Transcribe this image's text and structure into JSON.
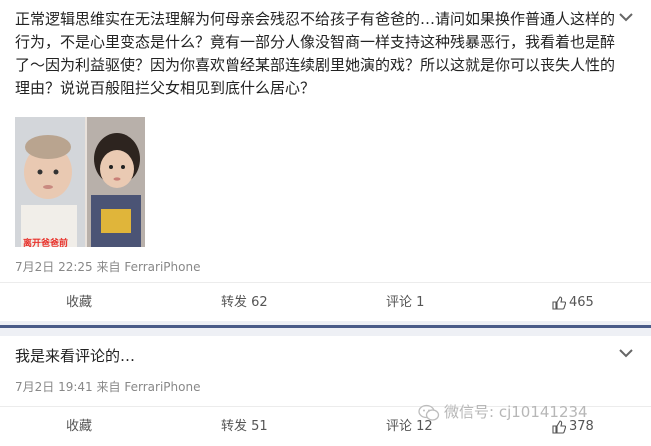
{
  "posts": [
    {
      "text_lines": [
        "正常逻辑思维实在无法理解为何母亲会残忍不给孩子有爸爸的…请问如果换作普通人这样的",
        "行为，不是心里变态是什么？竟有一部分人像没智商一样支持这种残暴恶行，我看着也是醉",
        "了～因为利益驱使？因为你喜欢曾经某部连续剧里她演的戏？所以这就是你可以丧失人性的",
        "理由？说说百般阻拦父女相见到底什么居心？"
      ],
      "image_caption": "离开爸爸前",
      "date": "7月2日",
      "time": "22:25",
      "via": "来自",
      "source": "FerrariPhone",
      "actions": {
        "favorite": "收藏",
        "forward": "转发 62",
        "comment": "评论 1",
        "likes": "465"
      }
    },
    {
      "text_lines": [
        "我是来看评论的…"
      ],
      "date": "7月2日",
      "time": "19:41",
      "via": "来自",
      "source": "FerrariPhone",
      "actions": {
        "favorite": "收藏",
        "forward": "转发 51",
        "comment": "评论 12",
        "likes": "378"
      }
    }
  ],
  "watermark": "微信号: cj10141234",
  "icons": {
    "menu": "chevron-down-icon",
    "like": "thumbs-up-icon",
    "watermark": "wechat-icon"
  },
  "colors": {
    "separator": "#4a5b88",
    "meta_text": "#888888",
    "caption": "#e8322c"
  }
}
